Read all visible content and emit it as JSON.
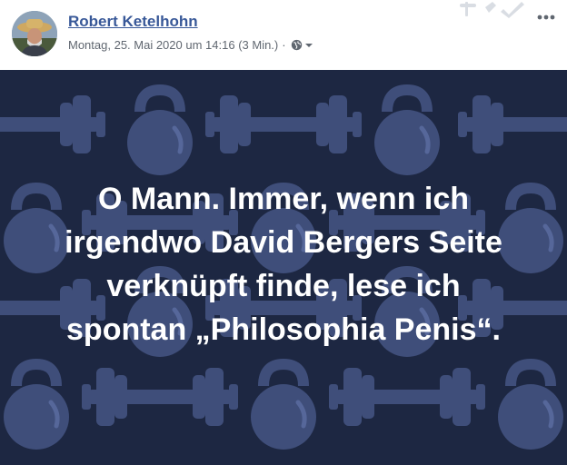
{
  "author": {
    "name": "Robert Ketelhohn",
    "avatar_icon": "profile-photo"
  },
  "meta": {
    "date": "Montag, 25. Mai 2020 um 14:16",
    "read_time": "(3 Min.)",
    "separator": "·",
    "audience_icon": "globe-icon",
    "audience_dropdown_icon": "caret-down-icon"
  },
  "menu": {
    "more_icon": "more-dots-icon"
  },
  "post_image": {
    "background_color": "#1d2742",
    "pattern_color": "#3f4e7a",
    "pattern_icons": [
      "dumbbell-icon",
      "kettlebell-icon"
    ],
    "lines": [
      "O Mann. Immer, wenn ich",
      "irgendwo David Bergers Seite",
      "verknüpft finde, lese ich",
      "spontan „Philosophia Penis“."
    ]
  },
  "colors": {
    "link": "#385898",
    "meta_text": "#606770",
    "quote_text": "#ffffff"
  }
}
